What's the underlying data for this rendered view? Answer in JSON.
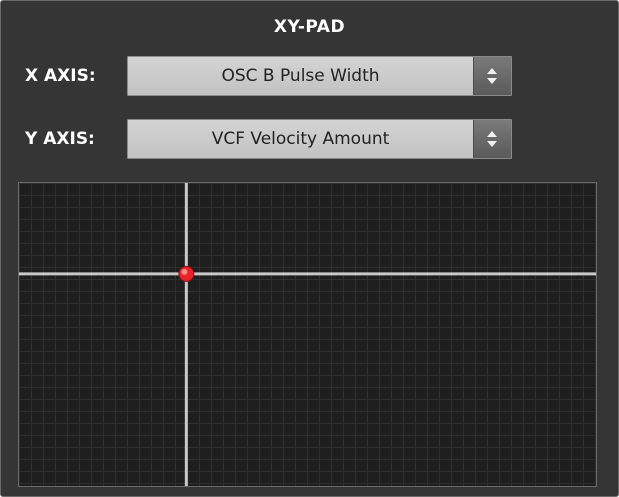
{
  "panel": {
    "title": "XY-PAD"
  },
  "x_axis": {
    "label": "X AXIS:",
    "selected": "OSC B Pulse Width"
  },
  "y_axis": {
    "label": "Y AXIS:",
    "selected": "VCF Velocity Amount"
  },
  "pad": {
    "x_value": 0.29,
    "y_value": 0.7,
    "crosshair_color": "#c8c8c8",
    "handle_color": "#e8232a"
  },
  "icons": {
    "select_arrows": "up-down-chevron-icon"
  }
}
